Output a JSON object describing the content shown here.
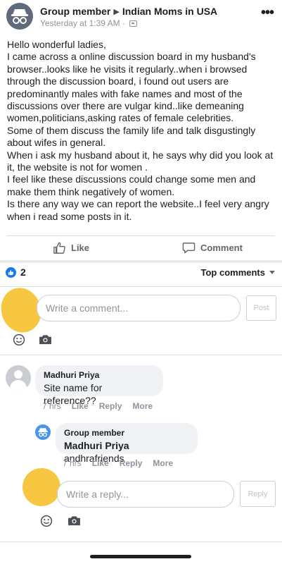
{
  "post": {
    "author": "Group member",
    "group": "Indian Moms in USA",
    "timestamp": "Yesterday at 1:39 AM",
    "separator": "·",
    "body_lines": [
      "Hello wonderful ladies,",
      "I came across a online discussion board in my husband's browser..looks like he visits it regularly..when i browsed through the discussion board, i found out users are predominantly males with fake names and most of the discussions over there are vulgar kind..like demeaning women,politicians,asking rates of female celebrities.",
      "Some of them discuss the family life and talk disgustingly about wifes in general.",
      "When i ask my husband about it, he says why did you look at it, the website is not for women .",
      "I feel like these discussions could change some men and make them think negatively of women.",
      "Is there any way we can report the website..I feel very angry when i read some posts in it."
    ]
  },
  "actions": {
    "like": "Like",
    "comment": "Comment"
  },
  "reactions": {
    "count": "2",
    "sort_label": "Top comments"
  },
  "composer": {
    "placeholder": "Write a comment...",
    "post_label": "Post"
  },
  "comments": [
    {
      "author": "Madhuri Priya",
      "text": "Site name for reference??",
      "time": "7 hrs",
      "like": "Like",
      "reply": "Reply",
      "more": "More"
    }
  ],
  "reply": {
    "author": "Group member",
    "mention": "Madhuri Priya",
    "text": " andhrafriends",
    "time": "7 hrs",
    "like": "Like",
    "reply": "Reply",
    "more": "More"
  },
  "reply_composer": {
    "placeholder": "Write a reply...",
    "reply_label": "Reply"
  },
  "colors": {
    "accent": "#1877f2",
    "text": "#1c1e21",
    "muted": "#8d949e",
    "bubble": "#f0f2f5",
    "highlight": "#f6c12c"
  }
}
